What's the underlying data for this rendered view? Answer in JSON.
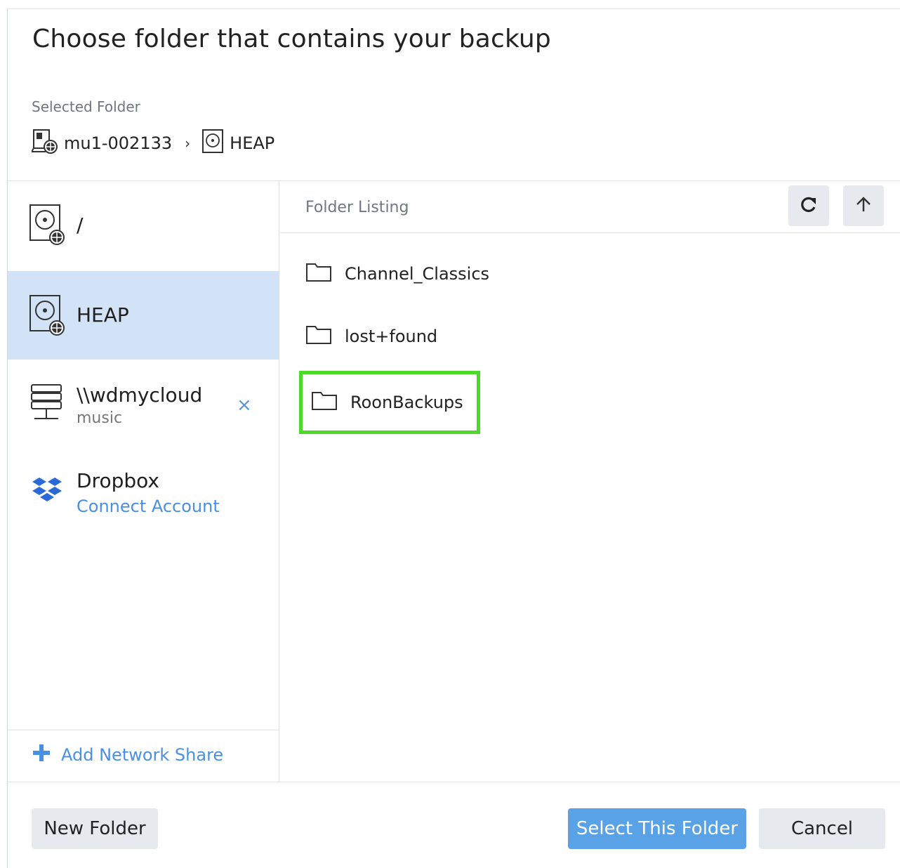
{
  "dialog": {
    "title": "Choose folder that contains your backup",
    "selected_folder_label": "Selected Folder",
    "breadcrumb": [
      {
        "label": "mu1-002133",
        "icon": "computer-icon"
      },
      {
        "label": "HEAP",
        "icon": "drive-icon"
      }
    ],
    "breadcrumb_separator": "›"
  },
  "sidebar": {
    "items": [
      {
        "name": "/",
        "icon": "hard-drive-icon",
        "selected": false
      },
      {
        "name": "HEAP",
        "icon": "hard-drive-icon",
        "selected": true
      },
      {
        "name": "\\\\wdmycloud",
        "sub": "music",
        "icon": "server-icon",
        "close": "×"
      },
      {
        "name": "Dropbox",
        "link": "Connect Account",
        "icon": "dropbox-icon"
      }
    ],
    "add_network_share": "Add Network Share"
  },
  "listing": {
    "label": "Folder Listing",
    "refresh_icon": "refresh-icon",
    "up_icon": "arrow-up-icon",
    "folders": [
      {
        "name": "Channel_Classics"
      },
      {
        "name": "lost+found"
      },
      {
        "name": "RoonBackups",
        "highlighted": true
      }
    ],
    "highlight_color": "#4cd92a"
  },
  "footer": {
    "new_folder": "New Folder",
    "select_folder": "Select This Folder",
    "cancel": "Cancel"
  },
  "colors": {
    "accent": "#4a90e2",
    "selected_bg": "#d3e3f7",
    "primary_button": "#5aa2e6"
  }
}
